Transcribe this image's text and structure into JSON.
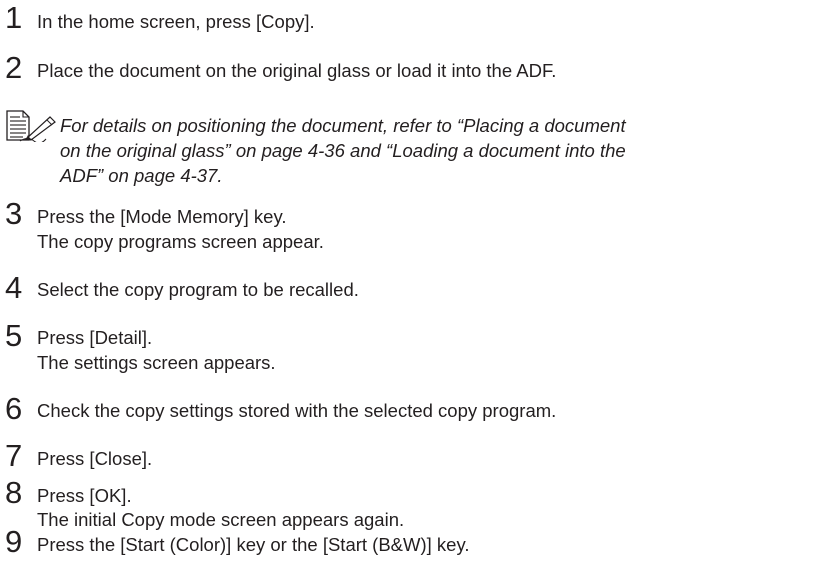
{
  "steps": [
    {
      "number": "1",
      "lines": [
        "In the home screen, press [Copy]."
      ]
    },
    {
      "number": "2",
      "lines": [
        "Place the document on the original glass or load it into the ADF."
      ]
    },
    {
      "number": "3",
      "lines": [
        "Press the [Mode Memory] key.",
        "The copy programs screen appear."
      ]
    },
    {
      "number": "4",
      "lines": [
        "Select the copy program to be recalled."
      ]
    },
    {
      "number": "5",
      "lines": [
        "Press [Detail].",
        "The settings screen appears."
      ]
    },
    {
      "number": "6",
      "lines": [
        "Check the copy settings stored with the selected copy program."
      ]
    },
    {
      "number": "7",
      "lines": [
        "Press [Close]."
      ]
    },
    {
      "number": "8",
      "lines": [
        "Press [OK].",
        "The initial Copy mode screen appears again."
      ]
    },
    {
      "number": "9",
      "lines": [
        "Press the [Start (Color)] key or the [Start (B&W)] key."
      ]
    }
  ],
  "note": {
    "icon": "note-pencil-icon",
    "lines": [
      "For details on positioning the document, refer to “Placing a document",
      "on the original glass” on page 4-36 and “Loading a document into the",
      "ADF” on page 4-37."
    ]
  }
}
